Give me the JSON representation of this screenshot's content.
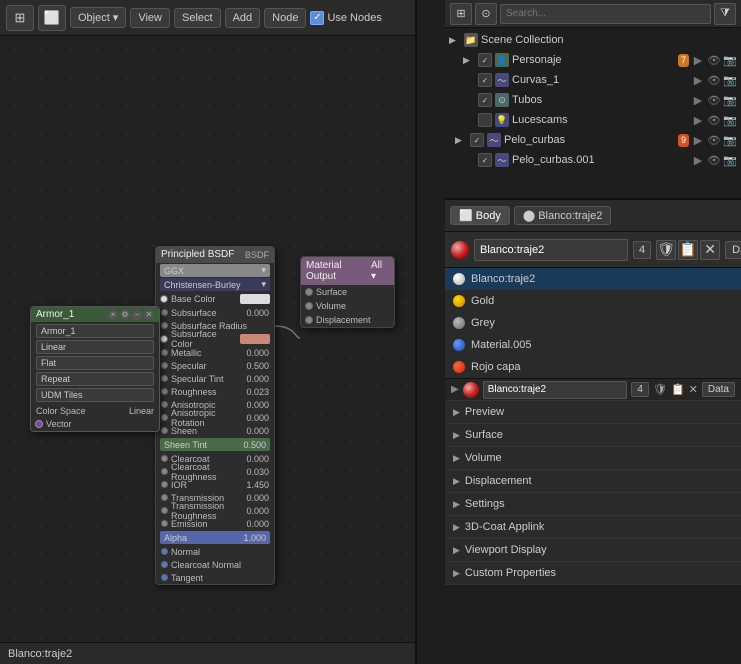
{
  "toolbar": {
    "editor_type": "⊞",
    "object_mode": "Object",
    "view_label": "View",
    "select_label": "Select",
    "add_label": "Add",
    "node_label": "Node",
    "use_nodes_label": "Use Nodes"
  },
  "outliner": {
    "title": "Scene Collection",
    "items": [
      {
        "name": "Personaje",
        "icon": "👤",
        "indent": 1,
        "badge": "7",
        "badge_color": "#cc7722",
        "has_badge": true
      },
      {
        "name": "Curvas_1",
        "icon": "〜",
        "indent": 1,
        "has_badge": false
      },
      {
        "name": "Tubos",
        "icon": "⊙",
        "indent": 1,
        "has_badge": false
      },
      {
        "name": "Lucescams",
        "icon": "💡",
        "indent": 1,
        "has_badge": false
      },
      {
        "name": "Pelo_curbas",
        "icon": "〜",
        "indent": 1,
        "badge": "9",
        "badge_color": "#cc5522",
        "has_badge": true
      },
      {
        "name": "Pelo_curbas.001",
        "icon": "〜",
        "indent": 1,
        "has_badge": false
      }
    ]
  },
  "material_list": {
    "items": [
      {
        "name": "Blanco:traje2",
        "type": "white",
        "selected": true
      },
      {
        "name": "Gold",
        "type": "gold",
        "selected": false
      },
      {
        "name": "Grey",
        "type": "grey",
        "selected": false
      },
      {
        "name": "Material.005",
        "type": "blue",
        "selected": false
      },
      {
        "name": "Rojo capa",
        "type": "red",
        "selected": false
      }
    ]
  },
  "material_header": {
    "name": "Blanco:traje2",
    "count": "4",
    "data_label": "Data"
  },
  "sections": [
    {
      "label": "Preview",
      "expanded": false
    },
    {
      "label": "Surface",
      "expanded": false
    },
    {
      "label": "Volume",
      "expanded": false
    },
    {
      "label": "Displacement",
      "expanded": false
    },
    {
      "label": "Settings",
      "expanded": false
    },
    {
      "label": "3D-Coat Applink",
      "expanded": false
    },
    {
      "label": "Viewport Display",
      "expanded": false
    },
    {
      "label": "Custom Properties",
      "expanded": false
    }
  ],
  "nodes": {
    "principled": {
      "title": "Principled BSDF",
      "output": "BSDF",
      "fields": [
        {
          "label": "GGX",
          "value": ""
        },
        {
          "label": "Christensen-Burley",
          "value": ""
        },
        {
          "label": "Base Color",
          "value": "",
          "is_color": true
        },
        {
          "label": "Subsurface",
          "value": "0.000"
        },
        {
          "label": "Subsurface Radius",
          "value": ""
        },
        {
          "label": "Subsurface Color",
          "value": "",
          "is_color": true
        },
        {
          "label": "Metallic",
          "value": "0.000"
        },
        {
          "label": "Specular",
          "value": "0.500"
        },
        {
          "label": "Specular Tint",
          "value": "0.000"
        },
        {
          "label": "Roughness",
          "value": "0.023"
        },
        {
          "label": "Anisotropic",
          "value": "0.000"
        },
        {
          "label": "Anisotropic Rotation",
          "value": "0.000"
        },
        {
          "label": "Sheen",
          "value": "0.000"
        },
        {
          "label": "Sheen Tint",
          "value": "0.500"
        },
        {
          "label": "Clearcoat",
          "value": "0.000"
        },
        {
          "label": "Clearcoat Roughness",
          "value": "0.030"
        },
        {
          "label": "IOR",
          "value": "1.450"
        },
        {
          "label": "Transmission",
          "value": "0.000"
        },
        {
          "label": "Transmission Roughness",
          "value": "0.000"
        },
        {
          "label": "Emission",
          "value": "0.000"
        },
        {
          "label": "Alpha",
          "value": "1.000",
          "highlighted": true
        },
        {
          "label": "Normal",
          "value": ""
        },
        {
          "label": "Clearcoat Normal",
          "value": ""
        },
        {
          "label": "Tangent",
          "value": ""
        }
      ]
    },
    "material_output": {
      "title": "Material Output",
      "sockets": [
        "Surface",
        "Volume",
        "Displacement"
      ]
    },
    "armor": {
      "title": "Armor_1",
      "subtitle": "Armor_1",
      "fields": [
        "Linear",
        "Flat",
        "Repeat",
        "UDM Tiles"
      ],
      "color_space": "Linear",
      "vector": "Vector"
    }
  },
  "status_bar": {
    "label": "Blanco:traje2"
  },
  "icons": {
    "expand": "▶",
    "collapse": "▼",
    "check": "✓",
    "close": "✕",
    "search": "🔍",
    "filter": "⧩",
    "add": "+",
    "body": "Body",
    "data": "Data"
  }
}
